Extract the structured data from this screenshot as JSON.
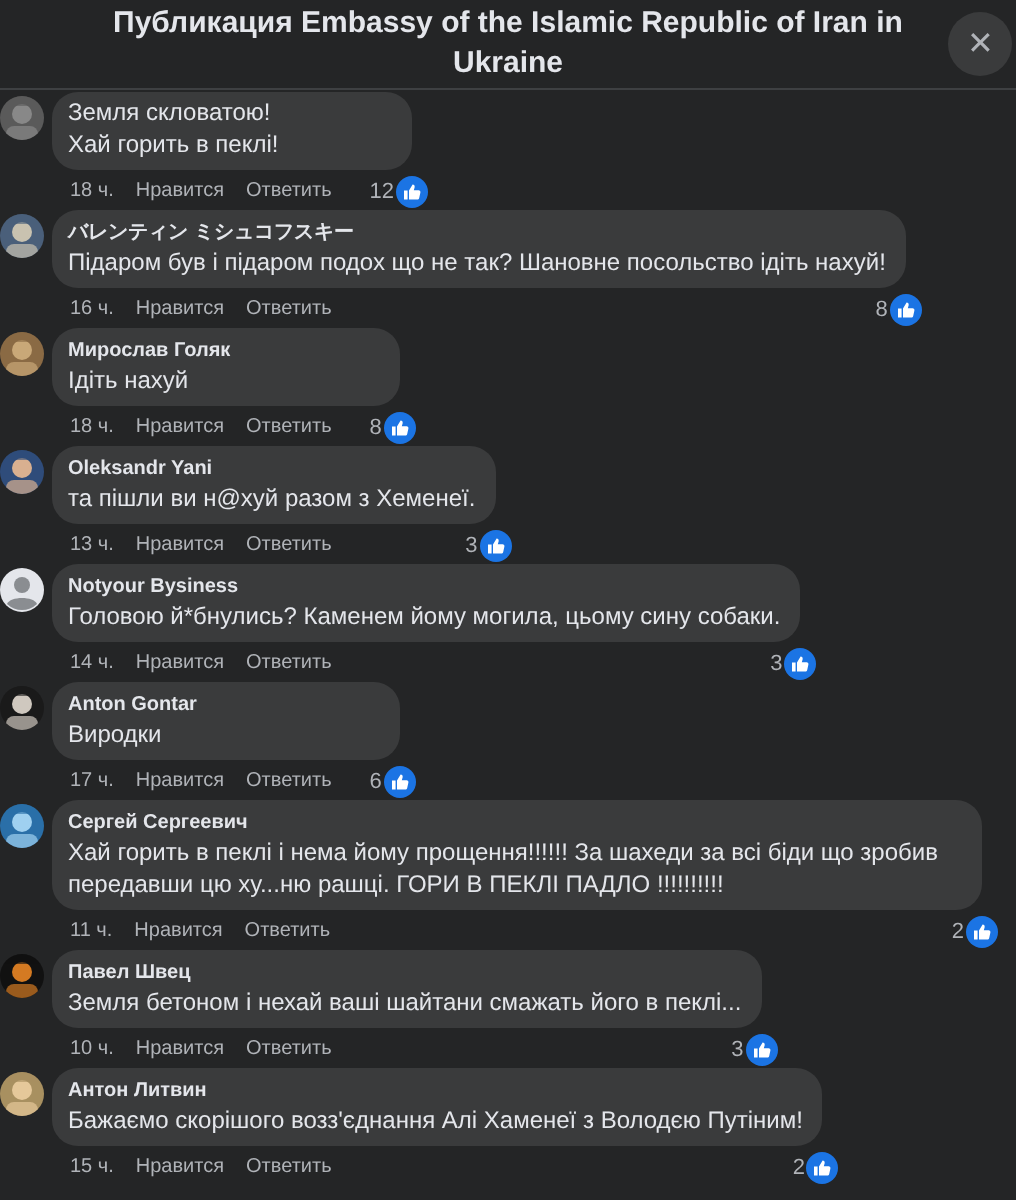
{
  "dialog": {
    "title": "Публикация Embassy of the Islamic Republic of Iran in Ukraine",
    "close": "✕"
  },
  "comments": [
    {
      "avatar": {
        "kind": "picture"
      },
      "lines": [
        "Земля скловатою!",
        "Хай горить в пеклі!"
      ],
      "time": "18 ч.",
      "like": "Нравится",
      "reply": "Ответить",
      "reactions": "12"
    },
    {
      "author": "バレンティン ミシュコフスキー",
      "avatar": {
        "kind": "picture"
      },
      "lines": [
        "Підаром був і підаром подох що не так? Шановне посольство ідіть нахуй!"
      ],
      "time": "16 ч.",
      "like": "Нравится",
      "reply": "Ответить",
      "reactions": "8"
    },
    {
      "author": "Мирослав Голяк",
      "avatar": {
        "kind": "picture"
      },
      "lines": [
        "Ідіть нахуй"
      ],
      "time": "18 ч.",
      "like": "Нравится",
      "reply": "Ответить",
      "reactions": "8"
    },
    {
      "author": "Oleksandr Yani",
      "avatar": {
        "kind": "picture"
      },
      "lines": [
        "та пішли ви н@хуй разом з Хеменеї."
      ],
      "time": "13 ч.",
      "like": "Нравится",
      "reply": "Ответить",
      "reactions": "3"
    },
    {
      "author": "Notyour Bysiness",
      "avatar": {
        "kind": "default"
      },
      "lines": [
        "Головою й*бнулись? Каменем йому могила, цьому сину собаки."
      ],
      "time": "14 ч.",
      "like": "Нравится",
      "reply": "Ответить",
      "reactions": "3"
    },
    {
      "author": "Anton Gontar",
      "avatar": {
        "kind": "picture"
      },
      "lines": [
        "Виродки"
      ],
      "time": "17 ч.",
      "like": "Нравится",
      "reply": "Ответить",
      "reactions": "6"
    },
    {
      "author": "Сергей Сергеевич",
      "avatar": {
        "kind": "picture"
      },
      "lines": [
        "Хай горить в пеклі і нема йому прощення!!!!!! За шахеди за всі біди що зробив передавши цю ху...ню рашці. ГОРИ В ПЕКЛІ ПАДЛО !!!!!!!!!!"
      ],
      "time": "11 ч.",
      "like": "Нравится",
      "reply": "Ответить",
      "reactions": "2"
    },
    {
      "author": "Павел Швец",
      "avatar": {
        "kind": "picture"
      },
      "lines": [
        "Земля бетоном і нехай ваші шайтани смажать його в пеклі..."
      ],
      "time": "10 ч.",
      "like": "Нравится",
      "reply": "Ответить",
      "reactions": "3"
    },
    {
      "author": "Антон Литвин",
      "avatar": {
        "kind": "picture"
      },
      "lines": [
        "Бажаємо скорішого возз'єднання Алі Хаменеї з Володєю Путіним!"
      ],
      "time": "15 ч.",
      "like": "Нравится",
      "reply": "Ответить",
      "reactions": "2"
    }
  ]
}
